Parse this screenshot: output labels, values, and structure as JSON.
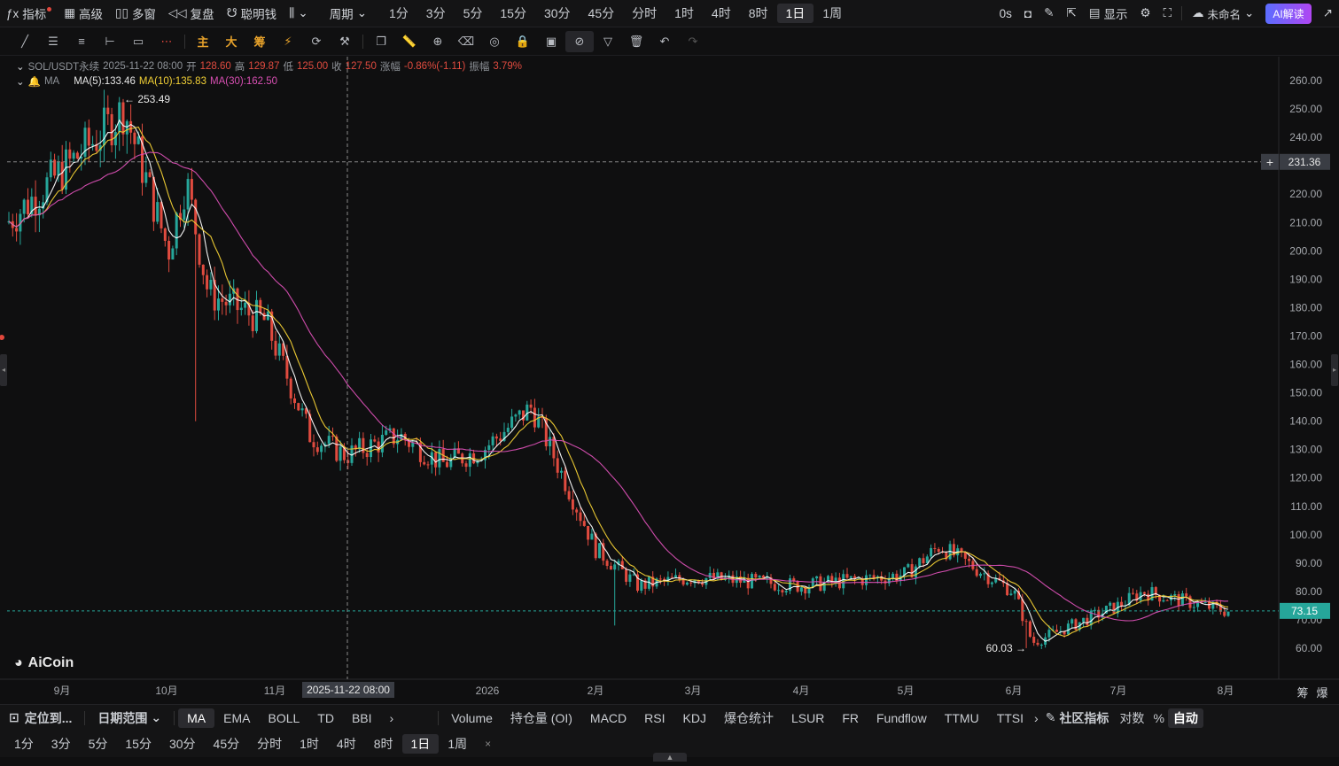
{
  "toolbar": {
    "indicators": "指标",
    "advanced": "高级",
    "multi_window": "多窗",
    "replay": "复盘",
    "smart_money": "聪明钱",
    "period": "周期",
    "timeframes": [
      "1分",
      "3分",
      "5分",
      "15分",
      "30分",
      "45分",
      "分时",
      "1时",
      "4时",
      "8时",
      "1日",
      "1周"
    ],
    "active_timeframe": "1日",
    "countdown": "0s",
    "display": "显示",
    "layout_name": "未命名",
    "ai_read": "AI解读"
  },
  "drawing_tools": {
    "main": "主",
    "large": "大",
    "chips": "筹"
  },
  "legend": {
    "symbol": "SOL/USDT永续",
    "date": "2025-11-22 08:00",
    "open_label": "开",
    "open": "128.60",
    "high_label": "高",
    "high": "129.87",
    "low_label": "低",
    "low": "125.00",
    "close_label": "收",
    "close": "127.50",
    "change_label": "涨幅",
    "change": "-0.86%(-1.11)",
    "amp_label": "振幅",
    "amp": "3.79%",
    "ma_title": "MA",
    "ma5": "MA(5):133.46",
    "ma10": "MA(10):135.83",
    "ma30": "MA(30):162.50"
  },
  "chart": {
    "crosshair_price": "231.36",
    "current_price": "73.15",
    "high_marker": "253.49",
    "low_marker": "60.03",
    "crosshair_date": "2025-11-22 08:00",
    "watermark": "AiCoin",
    "price_ticks": [
      "260.00",
      "250.00",
      "240.00",
      "230.00",
      "220.00",
      "210.00",
      "200.00",
      "190.00",
      "180.00",
      "170.00",
      "160.00",
      "150.00",
      "140.00",
      "130.00",
      "120.00",
      "110.00",
      "100.00",
      "90.00",
      "80.00",
      "70.00",
      "60.00"
    ],
    "date_ticks": [
      "9月",
      "10月",
      "11月",
      "2026",
      "2月",
      "3月",
      "4月",
      "5月",
      "6月",
      "7月",
      "8月"
    ],
    "corner_labels": [
      "筹",
      "爆"
    ],
    "colors": {
      "up": "#26a69a",
      "down": "#e04b3f",
      "ma5": "#ffffff",
      "ma10": "#f2d035",
      "ma30": "#d84fb3"
    }
  },
  "chart_data": {
    "type": "candlestick",
    "title": "SOL/USDT永续",
    "x_labels": [
      "9月",
      "10月",
      "11月",
      "2026",
      "2月",
      "3月",
      "4月",
      "5月",
      "6月",
      "7月",
      "8月"
    ],
    "ylim": [
      55,
      265
    ],
    "price_series_approx": [
      {
        "x": "9月",
        "y": 210
      },
      {
        "x": "9月中",
        "y": 240
      },
      {
        "x": "9月下",
        "y": 250
      },
      {
        "x": "10月",
        "y": 200
      },
      {
        "x": "10月中",
        "y": 225
      },
      {
        "x": "10月下",
        "y": 185
      },
      {
        "x": "11月",
        "y": 175
      },
      {
        "x": "11月中",
        "y": 135
      },
      {
        "x": "11月下",
        "y": 128
      },
      {
        "x": "12月",
        "y": 135
      },
      {
        "x": "12月下",
        "y": 125
      },
      {
        "x": "2026",
        "y": 130
      },
      {
        "x": "1月中",
        "y": 145
      },
      {
        "x": "2月",
        "y": 95
      },
      {
        "x": "2月中",
        "y": 82
      },
      {
        "x": "3月",
        "y": 85
      },
      {
        "x": "4月",
        "y": 82
      },
      {
        "x": "5月",
        "y": 86
      },
      {
        "x": "5月中",
        "y": 96
      },
      {
        "x": "6月",
        "y": 80
      },
      {
        "x": "6月中",
        "y": 62
      },
      {
        "x": "7月",
        "y": 75
      },
      {
        "x": "7月中",
        "y": 80
      },
      {
        "x": "8月",
        "y": 73
      }
    ],
    "markers": {
      "high": 253.49,
      "low": 60.03,
      "last": 73.15
    },
    "moving_averages": {
      "MA5": 133.46,
      "MA10": 135.83,
      "MA30": 162.5
    }
  },
  "indicator_bar": {
    "locate": "定位到...",
    "date_range": "日期范围",
    "main_indicators": [
      "MA",
      "EMA",
      "BOLL",
      "TD",
      "BBI"
    ],
    "active_main": "MA",
    "sub_indicators": [
      "Volume",
      "持仓量 (OI)",
      "MACD",
      "RSI",
      "KDJ",
      "爆仓统计",
      "LSUR",
      "FR",
      "Fundflow",
      "TTMU",
      "TTSI"
    ],
    "community": "社区指标",
    "log": "对数",
    "percent": "%",
    "auto": "自动"
  },
  "bottom_timeframes": [
    "1分",
    "3分",
    "5分",
    "15分",
    "30分",
    "45分",
    "分时",
    "1时",
    "4时",
    "8时",
    "1日",
    "1周"
  ],
  "bottom_active": "1日"
}
